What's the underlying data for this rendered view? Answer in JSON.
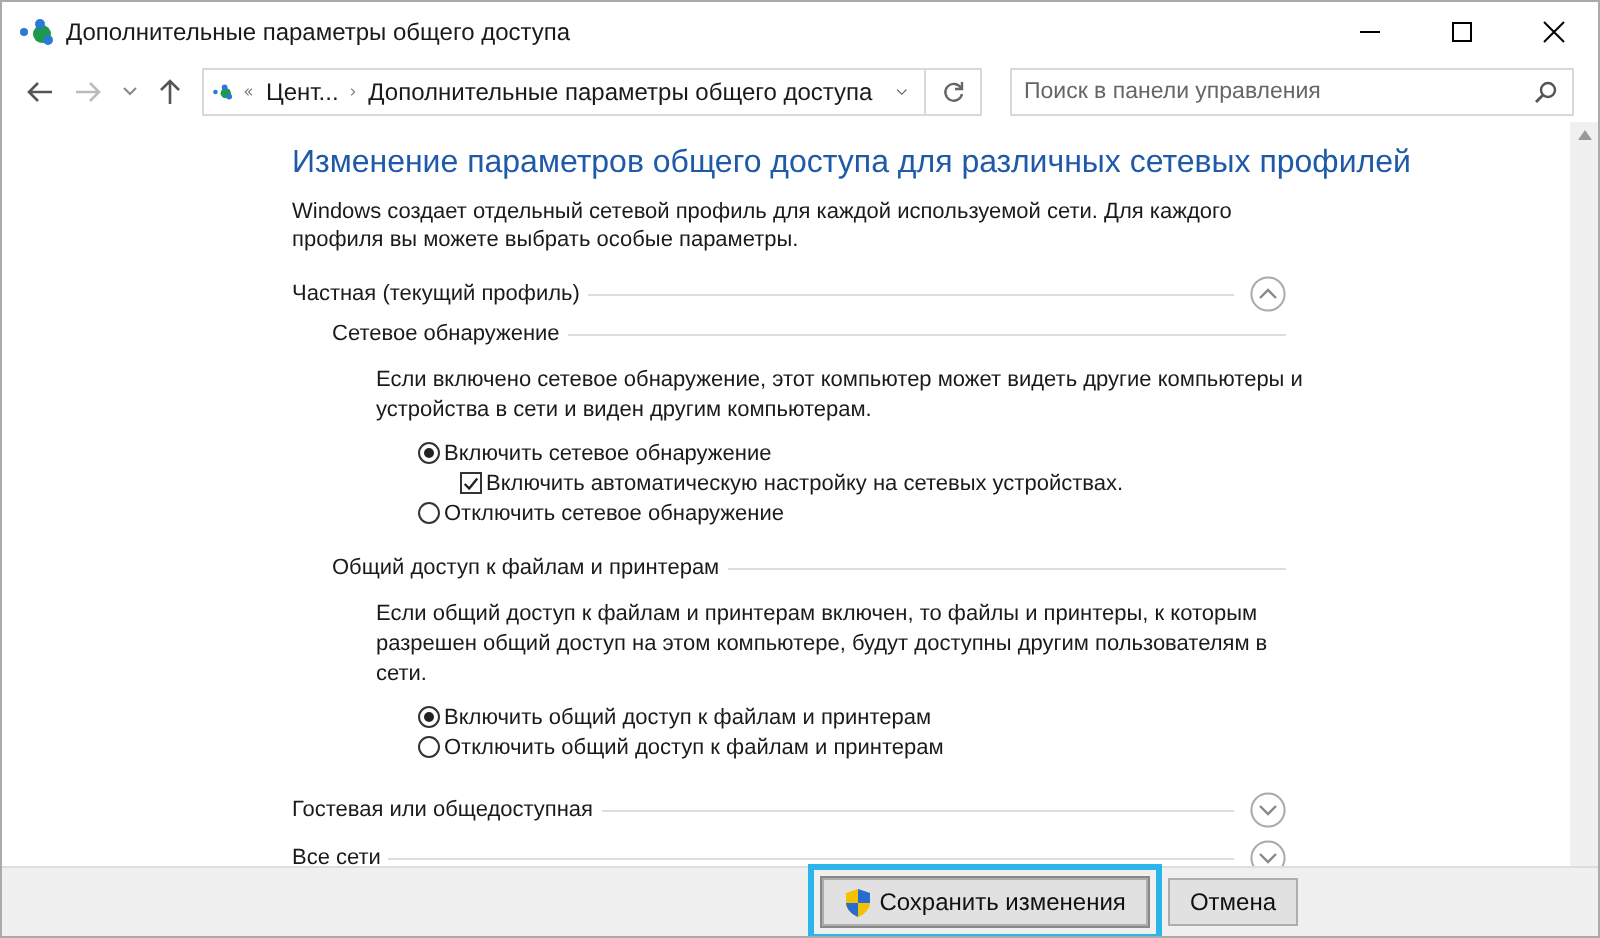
{
  "window": {
    "title": "Дополнительные параметры общего доступа"
  },
  "navigation": {
    "breadcrumb": [
      "Цент...",
      "Дополнительные параметры общего доступа"
    ],
    "search": {
      "placeholder": "Поиск в панели управления"
    }
  },
  "heading": "Изменение параметров общего доступа для различных сетевых профилей",
  "intro": "Windows создает отдельный сетевой профиль для каждой используемой сети. Для каждого профиля вы можете выбрать особые параметры.",
  "profiles": [
    {
      "name": "Частная (текущий профиль)",
      "expanded": true,
      "groups": [
        {
          "title": "Сетевое обнаружение",
          "description": "Если включено сетевое обнаружение, этот компьютер может видеть другие компьютеры и устройства в сети и виден другим компьютерам.",
          "options": [
            {
              "kind": "radio",
              "label": "Включить сетевое обнаружение",
              "selected": true
            },
            {
              "kind": "checkbox",
              "label": "Включить автоматическую настройку на сетевых устройствах.",
              "checked": true
            },
            {
              "kind": "radio",
              "label": "Отключить сетевое обнаружение",
              "selected": false
            }
          ]
        },
        {
          "title": "Общий доступ к файлам и принтерам",
          "description": "Если общий доступ к файлам и принтерам включен, то файлы и принтеры, к которым разрешен общий доступ на этом компьютере, будут доступны другим пользователям в сети.",
          "options": [
            {
              "kind": "radio",
              "label": "Включить общий доступ к файлам и принтерам",
              "selected": true
            },
            {
              "kind": "radio",
              "label": "Отключить общий доступ к файлам и принтерам",
              "selected": false
            }
          ]
        }
      ]
    },
    {
      "name": "Гостевая или общедоступная",
      "expanded": false
    },
    {
      "name": "Все сети",
      "expanded": false
    }
  ],
  "buttons": [
    {
      "label": "Сохранить изменения",
      "highlighted": true,
      "shield": true
    },
    {
      "label": "Отмена",
      "highlighted": false,
      "shield": false
    }
  ]
}
